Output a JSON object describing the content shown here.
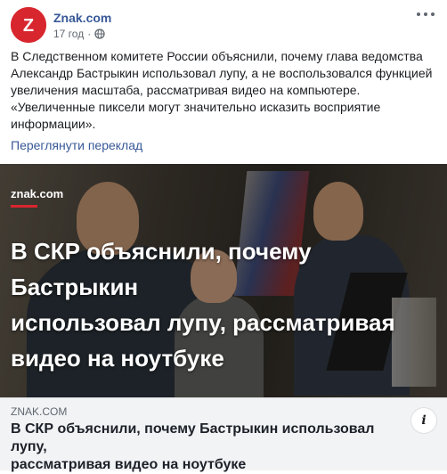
{
  "header": {
    "avatar_letter": "Z",
    "page_name": "Znak.com",
    "timestamp": "17 год",
    "separator": "·",
    "privacy_icon": "globe-icon",
    "more_icon": "more-horizontal-icon"
  },
  "post": {
    "text_lines": [
      "В Следственном комитете России объяснили, почему глава ведомства",
      "Александр Бастрыкин использовал лупу, а не воспользовался функцией",
      "увеличения масштаба, рассматривая видео на компьютере.",
      "«Увеличенные пиксели могут значительно исказить восприятие",
      "информации»."
    ],
    "translate_link": "Переглянути переклад"
  },
  "media": {
    "logo": "znak.com",
    "headline_lines": [
      "В СКР объяснили, почему Бастрыкин",
      "использовал лупу, рассматривая",
      "видео на ноутбуке"
    ]
  },
  "link_preview": {
    "domain": "ZNAK.COM",
    "title_lines": [
      "В СКР объяснили, почему Бастрыкин использовал лупу,",
      "рассматривая видео на ноутбуке"
    ],
    "info_icon": "info-icon",
    "info_glyph": "i"
  },
  "colors": {
    "brand_red": "#d8262f",
    "link_blue": "#385898",
    "preview_bg": "#f2f3f5"
  }
}
